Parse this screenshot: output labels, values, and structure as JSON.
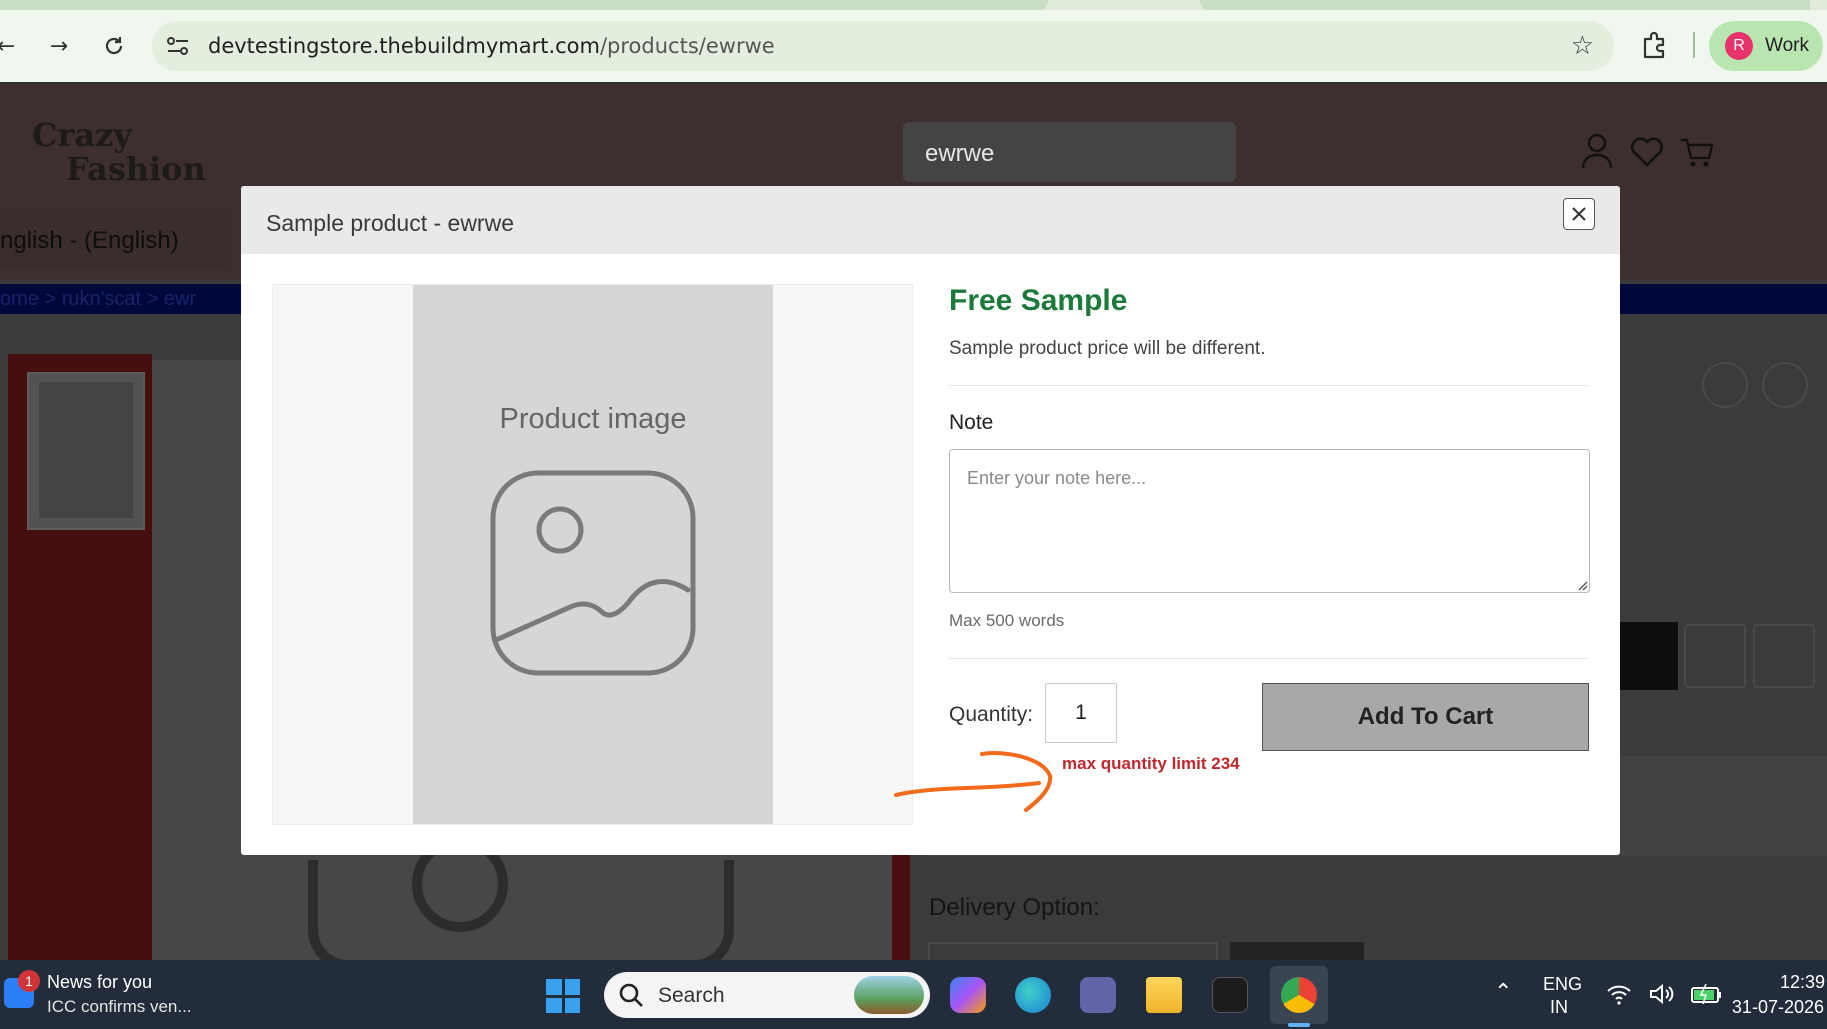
{
  "browser": {
    "url_host": "devtestingstore.thebuildmymart.com",
    "url_path": "/products/ewrwe",
    "profile_initial": "R",
    "profile_label": "Work",
    "colors": {
      "chrome_bg": "#f0f7ee",
      "profile_chip": "#b9e6b0",
      "avatar": "#e8336a"
    }
  },
  "page": {
    "logo_line1": "Crazy",
    "logo_line2": "Fashion",
    "search_value": "ewrwe",
    "language": "nglish - (English)",
    "breadcrumb": "ome  >  rukn'scat  >  ewr",
    "delivery_label": "Delivery Option:"
  },
  "modal": {
    "title": "Sample product - ewrwe",
    "image_placeholder_label": "Product image",
    "free_sample_title": "Free Sample",
    "free_sample_subtitle": "Sample product price will be different.",
    "note_label": "Note",
    "note_placeholder": "Enter your note here...",
    "note_hint": "Max 500 words",
    "quantity_label": "Quantity:",
    "quantity_value": "1",
    "quantity_limit_text": "max quantity limit 234",
    "add_to_cart_label": "Add To Cart",
    "colors": {
      "free_sample": "#1b7a3a",
      "limit_text": "#c0272d",
      "annotation_arrow": "#f26a1b",
      "add_to_cart_bg": "#a8a8a8"
    }
  },
  "taskbar": {
    "news_badge": "1",
    "news_title": "News for you",
    "news_subtitle": "ICC confirms ven...",
    "search_label": "Search",
    "lang_line1": "ENG",
    "lang_line2": "IN",
    "time": "12:39",
    "date": "31-07-2026",
    "apps": [
      "copilot-icon",
      "edge-icon",
      "teams-icon",
      "file-explorer-icon",
      "app-cube-icon",
      "chrome-icon"
    ]
  }
}
